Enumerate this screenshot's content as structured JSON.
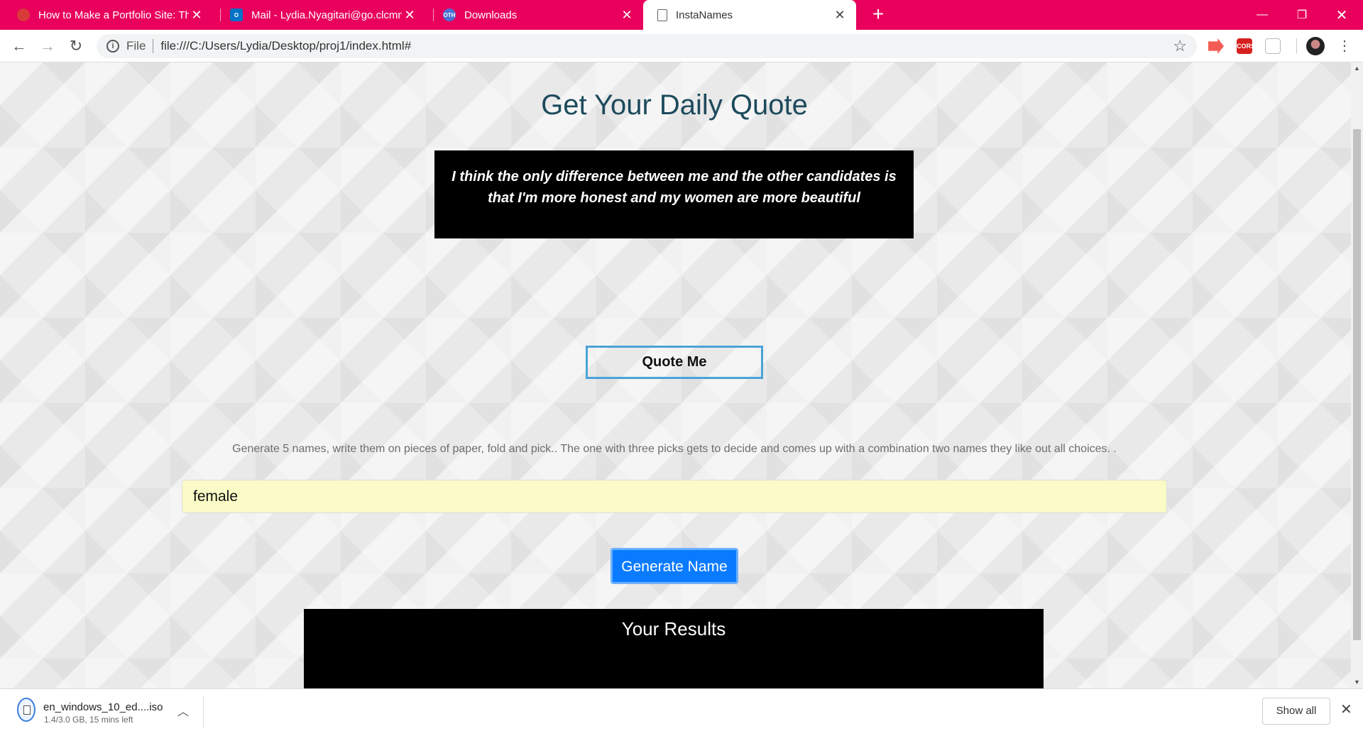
{
  "browser": {
    "tabs": [
      {
        "title": "How to Make a Portfolio Site: The",
        "favicon": "red-circle-icon",
        "active": false
      },
      {
        "title": "Mail - Lydia.Nyagitari@go.clcmn.",
        "favicon": "outlook-icon",
        "active": false
      },
      {
        "title": "Downloads",
        "favicon": "chrome-downloads-icon",
        "active": false
      },
      {
        "title": "InstaNames",
        "favicon": "document-icon",
        "active": true
      }
    ],
    "tab_bar_color": "#e8005c",
    "address": {
      "scheme_label": "File",
      "url": "file:///C:/Users/Lydia/Desktop/proj1/index.html#"
    },
    "extensions": [
      {
        "name": "cast-extension-icon",
        "label": "",
        "color": "#f25c54"
      },
      {
        "name": "cors-extension-icon",
        "label": "CORS",
        "color": "#d6201f"
      },
      {
        "name": "grey-extension-icon",
        "label": "",
        "color": "#cfcfcf"
      }
    ]
  },
  "page": {
    "title": "Get Your Daily Quote",
    "quote": "I think the only difference between me and the other candidates is that I'm more honest and my women are more beautiful",
    "quote_button": "Quote Me",
    "instructions": "Generate 5 names, write them on pieces of paper, fold and pick.. The one with three picks gets to decide and comes up with a combination two names they like out all choices. .",
    "name_input": {
      "value": "female"
    },
    "generate_button": "Generate Name",
    "results_title": "Your Results",
    "accent_color": "#0a7bff"
  },
  "downloads": {
    "file_name": "en_windows_10_ed....iso",
    "status": "1.4/3.0 GB, 15 mins left",
    "show_all": "Show all"
  }
}
